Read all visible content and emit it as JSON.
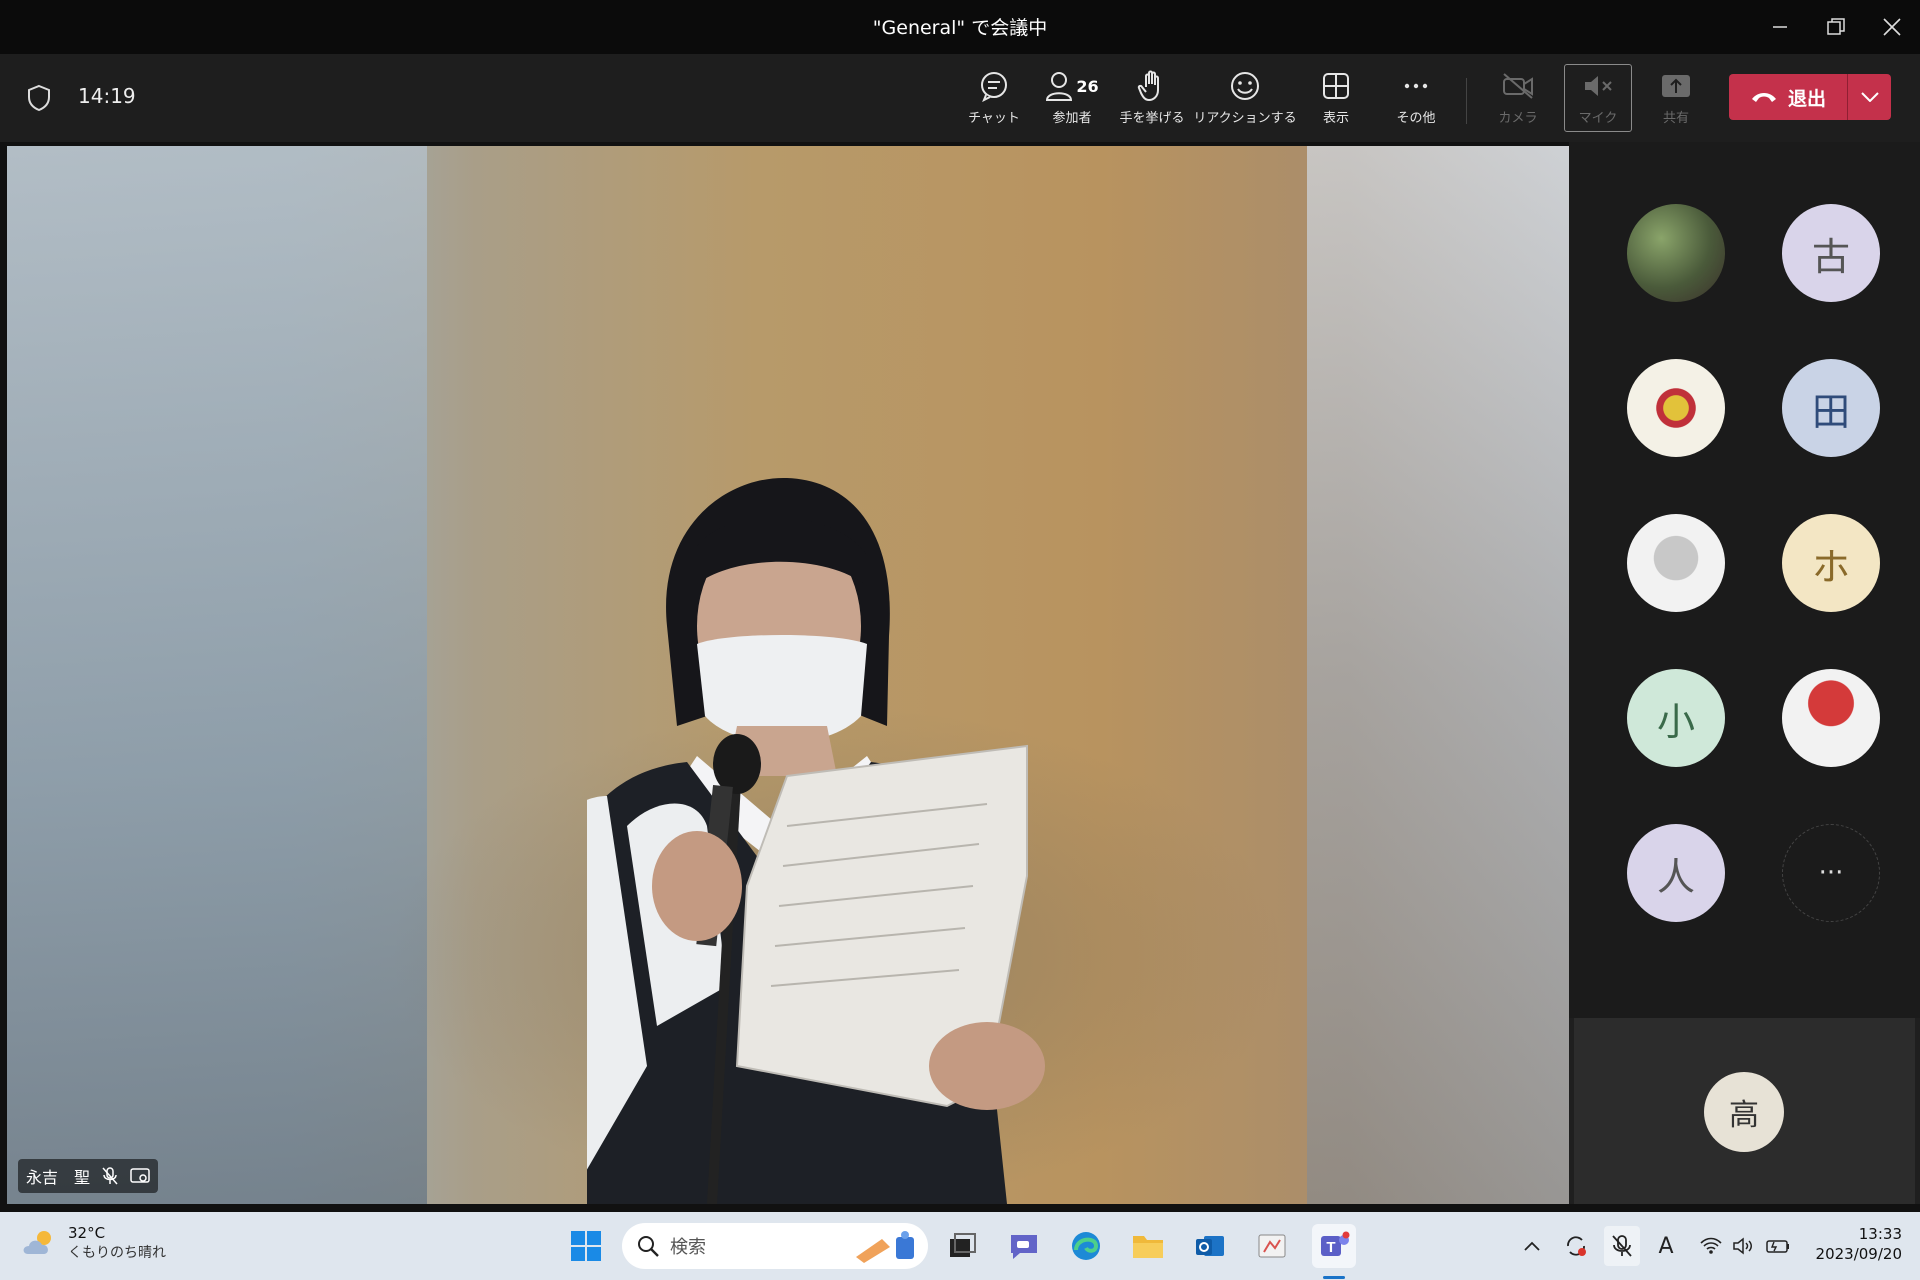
{
  "window": {
    "title": "\"General\" で会議中"
  },
  "toolbar": {
    "time": "14:19",
    "chat_label": "チャット",
    "participants_label": "参加者",
    "participants_count": "26",
    "raise_hand_label": "手を挙げる",
    "react_label": "リアクションする",
    "view_label": "表示",
    "more_label": "その他",
    "camera_label": "カメラ",
    "mic_label": "マイク",
    "share_label": "共有",
    "leave_label": "退出"
  },
  "video": {
    "speaker_name": "永吉　聖"
  },
  "panel": {
    "participants": [
      {
        "name": "",
        "initial": "",
        "icon": "photo-avatar",
        "color": "#4a5a3a"
      },
      {
        "name": "",
        "initial": "古",
        "icon": "initial-avatar",
        "color": "#d9d4ea"
      },
      {
        "name": "",
        "initial": "",
        "icon": "badge-avatar",
        "color": "#f4f1e6"
      },
      {
        "name": "",
        "initial": "田",
        "icon": "initial-avatar",
        "color": "#c9d3e6"
      },
      {
        "name": "",
        "initial": "",
        "icon": "character-avatar",
        "color": "#f2f2f2"
      },
      {
        "name": "",
        "initial": "ホ",
        "icon": "initial-avatar",
        "color": "#f3e6c4"
      },
      {
        "name": "",
        "initial": "小",
        "icon": "initial-avatar",
        "color": "#cfe8d9"
      },
      {
        "name": "",
        "initial": "",
        "icon": "character-avatar",
        "color": "#f2f2f2"
      },
      {
        "name": "",
        "initial": "人",
        "icon": "initial-avatar",
        "color": "#d9d4ea"
      },
      {
        "name": "",
        "initial": "···",
        "icon": "more-avatar",
        "color": "#1b1b1b"
      }
    ],
    "self_initial": "高"
  },
  "taskbar": {
    "weather_temp": "32°C",
    "weather_desc": "くもりのち晴れ",
    "search_placeholder": "検索",
    "time": "13:33",
    "date": "2023/09/20",
    "ime": "A"
  },
  "colors": {
    "leave": "#c4314b",
    "toolbar_bg": "#1e1e1e",
    "taskbar_bg": "#dfe6ee"
  }
}
